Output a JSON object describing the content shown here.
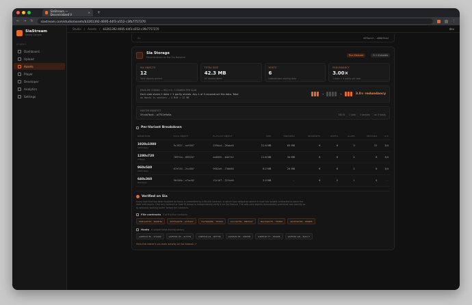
{
  "browser": {
    "tab_title": "SiaStream — Decentralized V",
    "url": "siastream.com/studio/assets/b3261392-4695-44f3-a552-c3fb7757370"
  },
  "sidebar": {
    "brand": "SiaStream",
    "brand_sub": "Studio Console",
    "section": "STUDIO",
    "items": [
      {
        "label": "Dashboard"
      },
      {
        "label": "Upload"
      },
      {
        "label": "Assets"
      },
      {
        "label": "Player"
      },
      {
        "label": "Developer"
      },
      {
        "label": "Analytics"
      },
      {
        "label": "Settings"
      }
    ]
  },
  "topbar": {
    "crumbs": [
      "Studio",
      "Assets",
      "b3261392-4695-44f3-a552-c3fb7757370"
    ],
    "account": "dev"
  },
  "stub": {
    "left": "01",
    "right": "d59acc2..a88b9ea4"
  },
  "storage": {
    "title": "Sia Storage",
    "subtitle": "Decentralized on the Sia Network",
    "badge": "Run Mainnet",
    "badge2": "3 + 6 shards",
    "stats": [
      {
        "label": "SIA OBJECTS",
        "value": "12",
        "sub": "Total objects pinned"
      },
      {
        "label": "TOTAL SIZE",
        "value": "42.3 MB",
        "sub": "All Variant items"
      },
      {
        "label": "HOSTS",
        "value": "6",
        "sub": "Independent storing data"
      },
      {
        "label": "REDUNDANCY",
        "value": "3.00×",
        "sub": "1 data + 2 parity per slab"
      }
    ],
    "coding_label": "ERASURE CODING — RS(1+2), 3 SHARDS PER SLAB",
    "coding_text": "Each slab stores 1 data + 2 parity shards. Any 1 of 3 reconstruct the data. Total",
    "coding_mono": "on Hosts 1× sectors → 4 MiB = 12 MB",
    "redundancy": "3.0× redundancy",
    "manifest_label": "MASTER MANIFEST",
    "manifest_hash": "3fcda7bc0..a7752e9a5a",
    "manifest_meta": [
      "780 B",
      "1 slab",
      "3 sectors",
      "on 3 hosts"
    ]
  },
  "variants": {
    "title": "Per-Variant Breakdown",
    "columns": [
      "RENDITION",
      "DATA OBJECT",
      "PLAYLIST OBJECT",
      "SIZE",
      "ENCODED",
      "SEGMENTS",
      "HOSTS",
      "SLABS",
      "SECTORS",
      "R/S"
    ],
    "rows": [
      {
        "res": "1920x1080",
        "sub": "5000 kbps",
        "data": "9c1927..ee9387",
        "playlist": "239bcd..26aba8",
        "size": "21.6 MB",
        "encoded": "65 MB",
        "segments": "6",
        "hosts": "6",
        "slabs": "3",
        "sectors": "12",
        "rs": "3/4"
      },
      {
        "res": "1280x720",
        "sub": "2 Mbps",
        "data": "789f2a..859287",
        "playlist": "da8055..bde742",
        "size": "11.6 MB",
        "encoded": "34 MB",
        "segments": "6",
        "hosts": "6",
        "slabs": "2",
        "sectors": "8",
        "rs": "3/4"
      },
      {
        "res": "960x540",
        "sub": "1400 kbps",
        "data": "67e744..2cc887",
        "playlist": "9982a9..73b688",
        "size": "6.2 MB",
        "encoded": "24 MB",
        "segments": "6",
        "hosts": "6",
        "slabs": "2",
        "sectors": "8",
        "rs": "3/4"
      },
      {
        "res": "640x360",
        "sub": "800 kbps",
        "data": "90f40b..e7ac82",
        "playlist": "f2c167..22fee8",
        "size": "2.9 MB",
        "encoded": "—",
        "segments": "6",
        "hosts": "0",
        "slabs": "1",
        "sectors": "0",
        "rs": "—"
      }
    ]
  },
  "verified": {
    "title": "Verified on Sia",
    "desc": "Every slab that has been finalized on hosts is committed by a file-file contract, in which host obligation where it must has hosted contracted to store the data until expiry. Click any contract or host ID below to independently verify it on Sia Siascan. The web-care objects immediately published was identify as to seriously working buffer before the contracts.",
    "contracts_label": "File contracts",
    "contracts_count": "5 of 6 active contracts",
    "contracts": [
      "932b1e5f79..9b98f5b",
      "493fda02f8..e7f5a5f",
      "73af5b9d8b..f91813",
      "b1c11bf0b..806fdd7",
      "0ba14e01f0..73b8b5",
      "2679799799..930805"
    ],
    "hosts_label": "Hosts",
    "hosts_count": "6 unique hosts storing sectors",
    "hosts": [
      "ed25519:3b..2c4e6b",
      "ed25519:41..4c7d79",
      "ed25519:e4..b0f746",
      "ed25519:01..23b7d8",
      "ed25519:7f..2d4a9b",
      "ed25519:a8..3e11c7"
    ],
    "link": "View this owner's on-chain activity on Sia Siascan ↗"
  },
  "colors": {
    "accent": "#e8692a",
    "bg": "#111111"
  }
}
